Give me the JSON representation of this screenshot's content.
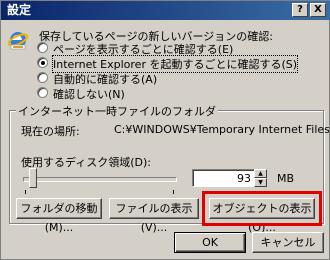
{
  "title": "設定",
  "title_buttons": {
    "help": "?",
    "close": "X"
  },
  "section_label": "保存しているページの新しいバージョンの確認:",
  "radio_options": [
    "ページを表示するごとに確認する(E)",
    "Internet Explorer を起動するごとに確認する(S)",
    "自動的に確認する(A)",
    "確認しない(N)"
  ],
  "selected_option_index": 1,
  "temp_folder": {
    "group_label": "インターネット一時ファイルのフォルダ",
    "location_label": "現在の場所:",
    "location_value": "C:¥WINDOWS¥Temporary Internet Files¥",
    "disk_usage_label": "使用するディスク領域(D):",
    "disk_value": "93",
    "unit": "MB",
    "buttons": {
      "move_folder": "フォルダの移動(M)...",
      "show_files": "ファイルの表示(V)...",
      "show_objects": "オブジェクトの表示(O)..."
    }
  },
  "footer": {
    "ok": "OK",
    "cancel": "キャンセル"
  },
  "highlight_color": "#e00000",
  "icons": [
    "ie-logo-icon",
    "help-icon",
    "close-icon",
    "spin-up-icon",
    "spin-down-icon"
  ]
}
